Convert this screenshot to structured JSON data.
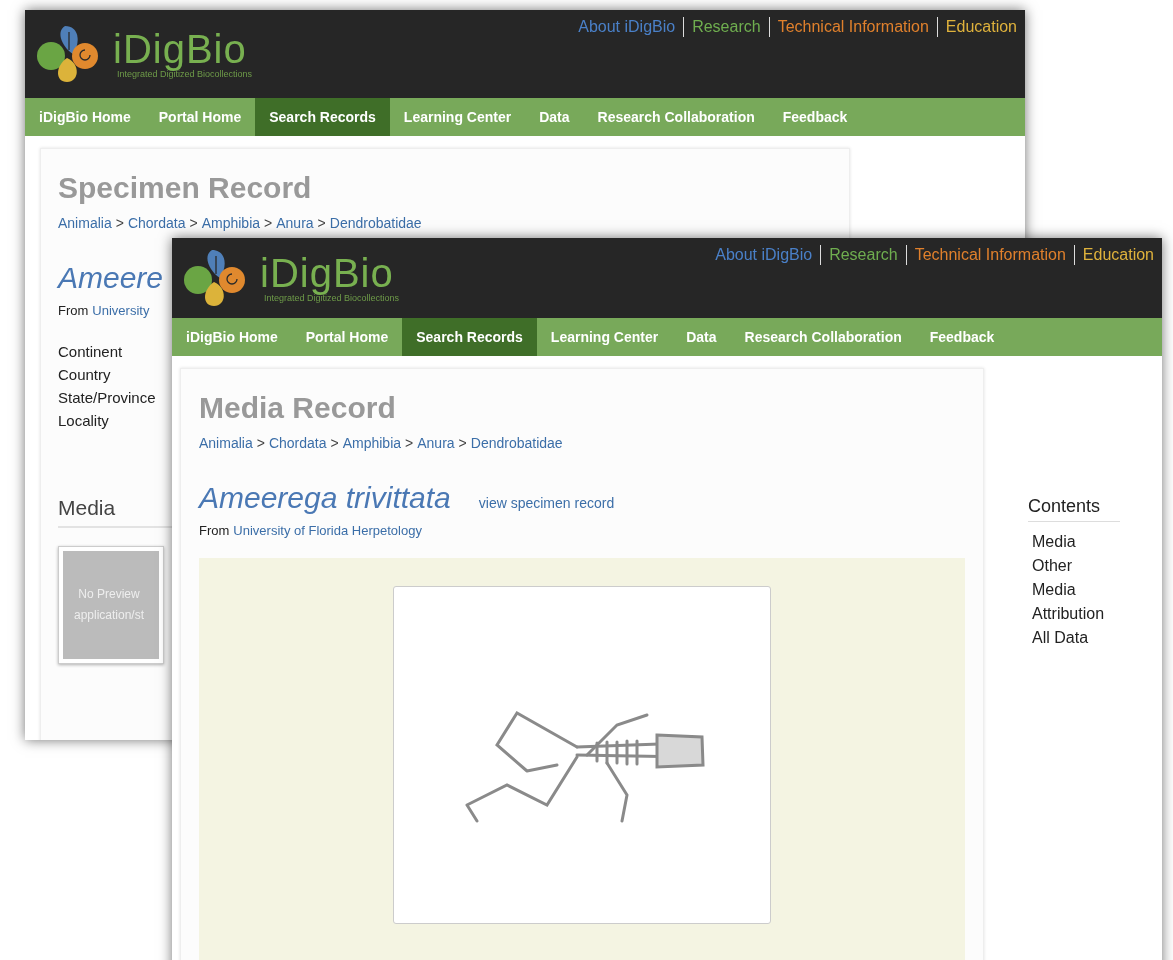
{
  "specimen_window": {
    "logo": {
      "name": "iDigBio",
      "tagline": "Integrated Digitized Biocollections"
    },
    "top_links": [
      {
        "label": "About iDigBio",
        "color": "#4a80c8"
      },
      {
        "label": "Research",
        "color": "#6fae4f"
      },
      {
        "label": "Technical Information",
        "color": "#e0802c"
      },
      {
        "label": "Education",
        "color": "#dfb23c"
      }
    ],
    "nav": [
      {
        "label": "iDigBio Home",
        "selected": false
      },
      {
        "label": "Portal Home",
        "selected": false
      },
      {
        "label": "Search Records",
        "selected": true
      },
      {
        "label": "Learning Center",
        "selected": false
      },
      {
        "label": "Data",
        "selected": false
      },
      {
        "label": "Research Collaboration",
        "selected": false
      },
      {
        "label": "Feedback",
        "selected": false
      }
    ],
    "title": "Specimen Record",
    "breadcrumb": [
      "Animalia",
      "Chordata",
      "Amphibia",
      "Anura",
      "Dendrobatidae"
    ],
    "separator": ">",
    "species": "Ameere",
    "source_prefix": "From",
    "source": "University",
    "fields": [
      "Continent",
      "Country",
      "State/Province",
      "Locality"
    ],
    "media_heading": "Media",
    "thumbnail": [
      "No Preview",
      "application/st"
    ]
  },
  "media_window": {
    "logo": {
      "name": "iDigBio",
      "tagline": "Integrated Digitized Biocollections"
    },
    "top_links": [
      {
        "label": "About iDigBio",
        "color": "#4a80c8"
      },
      {
        "label": "Research",
        "color": "#6fae4f"
      },
      {
        "label": "Technical Information",
        "color": "#e0802c"
      },
      {
        "label": "Education",
        "color": "#dfb23c"
      }
    ],
    "nav": [
      {
        "label": "iDigBio Home",
        "selected": false
      },
      {
        "label": "Portal Home",
        "selected": false
      },
      {
        "label": "Search Records",
        "selected": true
      },
      {
        "label": "Learning Center",
        "selected": false
      },
      {
        "label": "Data",
        "selected": false
      },
      {
        "label": "Research Collaboration",
        "selected": false
      },
      {
        "label": "Feedback",
        "selected": false
      }
    ],
    "title": "Media Record",
    "breadcrumb": [
      "Animalia",
      "Chordata",
      "Amphibia",
      "Anura",
      "Dendrobatidae"
    ],
    "separator": ">",
    "species": "Ameerega trivittata",
    "specimen_link": "view specimen record",
    "source_prefix": "From",
    "source": "University of Florida Herpetology",
    "contents": {
      "title": "Contents",
      "items": [
        "Media",
        "Other Media",
        "Attribution",
        "All Data"
      ]
    }
  }
}
